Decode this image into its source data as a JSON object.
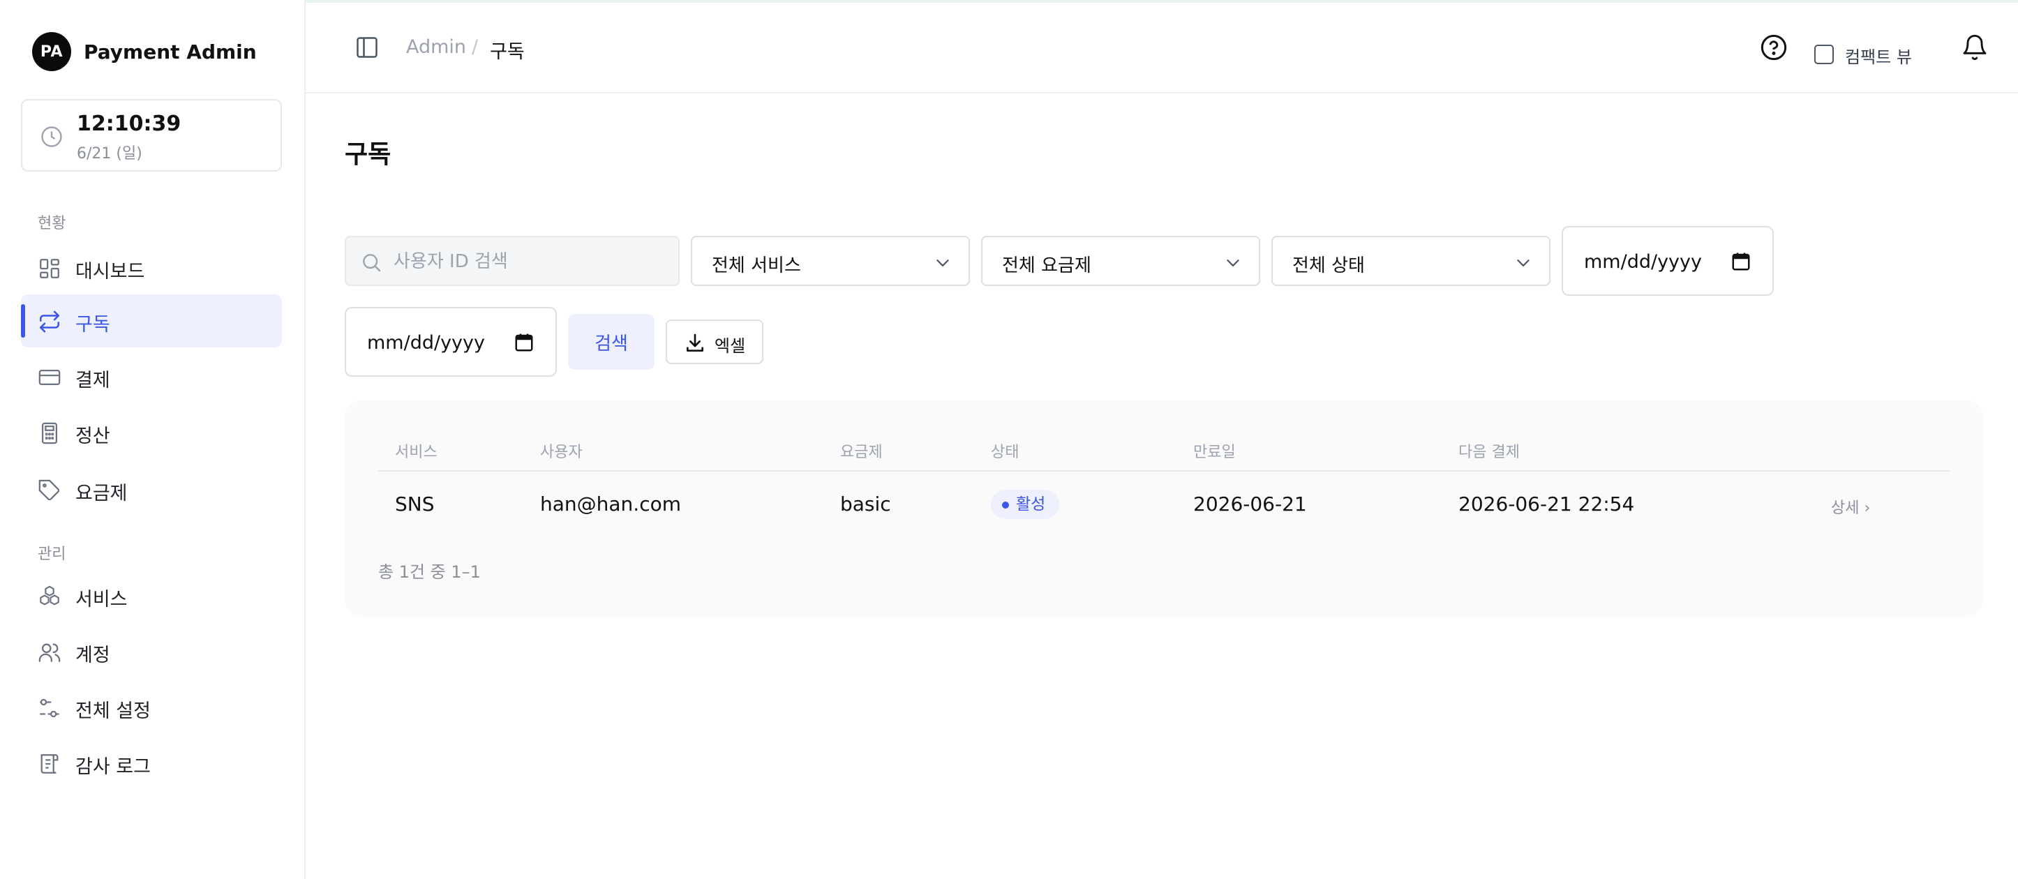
{
  "brand": {
    "logo": "PA",
    "name": "Payment Admin"
  },
  "clock": {
    "time": "12:10:39",
    "date": "6/21 (일)",
    "icon": "clock-icon"
  },
  "sidebar": {
    "sections": [
      {
        "label": "현황"
      },
      {
        "label": "관리"
      }
    ],
    "items": [
      {
        "label": "대시보드",
        "icon": "dashboard-grid-icon"
      },
      {
        "label": "구독",
        "icon": "repeat-arrows-icon",
        "active": true
      },
      {
        "label": "결제",
        "icon": "credit-card-icon"
      },
      {
        "label": "정산",
        "icon": "calculator-icon"
      },
      {
        "label": "요금제",
        "icon": "tag-icon"
      },
      {
        "label": "서비스",
        "icon": "cubes-icon"
      },
      {
        "label": "계정",
        "icon": "users-icon"
      },
      {
        "label": "전체 설정",
        "icon": "sliders-icon"
      },
      {
        "label": "감사 로그",
        "icon": "scroll-icon"
      }
    ]
  },
  "header": {
    "breadcrumb": [
      "Admin",
      "/",
      "구독"
    ],
    "compact_view_label": "컴팩트 뷰",
    "compact_view_checked": false
  },
  "page": {
    "title": "구독"
  },
  "filters": {
    "search_placeholder": "사용자 ID 검색",
    "service": "전체 서비스",
    "plan": "전체 요금제",
    "status": "전체 상태",
    "date_from": "mm/dd/yyyy",
    "date_to": "mm/dd/yyyy",
    "search_button": "검색",
    "excel_button": "엑셀"
  },
  "table": {
    "columns": [
      "서비스",
      "사용자",
      "요금제",
      "상태",
      "만료일",
      "다음 결제"
    ],
    "rows": [
      {
        "service": "SNS",
        "user": "han@han.com",
        "plan": "basic",
        "status": "활성",
        "expiry": "2026-06-21",
        "next_payment": "2026-06-21 22:54",
        "action": "상세 ›"
      }
    ],
    "pagination": "총 1건 중 1–1"
  },
  "colors": {
    "accent": "#3b55e6",
    "active_bg": "#eef0fd",
    "muted": "#8a8f98"
  }
}
